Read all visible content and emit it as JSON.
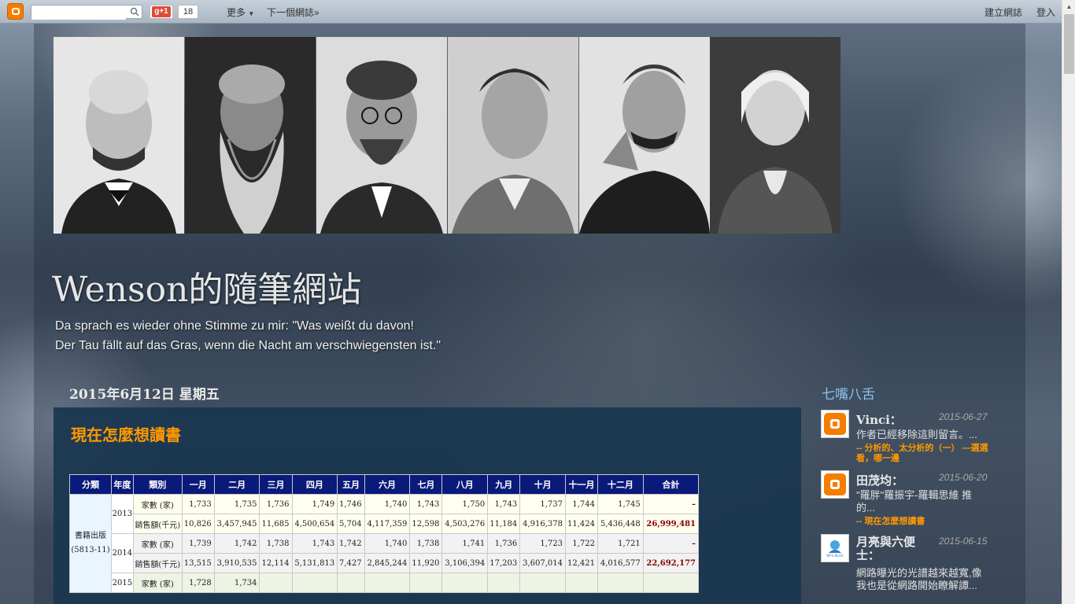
{
  "navbar": {
    "search_placeholder": "",
    "gplus_label": "+1",
    "gplus_g": "g",
    "plus_count": "18",
    "more": "更多",
    "next_blog": "下一個網誌»",
    "create_blog": "建立網誌",
    "login": "登入"
  },
  "header": {
    "title": "Wenson的隨筆網站",
    "description_line1": "Da sprach es wieder ohne Stimme zu mir: \"Was weißt du davon!",
    "description_line2": "Der Tau fällt auf das Gras, wenn die Nacht am verschwiegensten ist.\""
  },
  "post": {
    "date": "2015年6月12日 星期五",
    "title": "現在怎麼想讀書"
  },
  "table": {
    "headers": [
      "分類",
      "年度",
      "類別",
      "一月",
      "二月",
      "三月",
      "四月",
      "五月",
      "六月",
      "七月",
      "八月",
      "九月",
      "十月",
      "十一月",
      "十二月",
      "合計"
    ],
    "category": "書籍出版",
    "category_code": "(5813-11)",
    "type_count": "家數 (家)",
    "type_sales": "銷售額(千元)",
    "years": [
      {
        "year": "2013",
        "count": [
          "1,733",
          "1,735",
          "1,736",
          "1,749",
          "1,746",
          "1,740",
          "1,743",
          "1,750",
          "1,743",
          "1,737",
          "1,744",
          "1,745",
          "–"
        ],
        "sales": [
          "10,826",
          "3,457,945",
          "11,685",
          "4,500,654",
          "5,704",
          "4,117,359",
          "12,598",
          "4,503,276",
          "11,184",
          "4,916,378",
          "11,424",
          "5,436,448",
          "26,999,481"
        ]
      },
      {
        "year": "2014",
        "count": [
          "1,739",
          "1,742",
          "1,738",
          "1,743",
          "1,742",
          "1,740",
          "1,738",
          "1,741",
          "1,736",
          "1,723",
          "1,722",
          "1,721",
          "–"
        ],
        "sales": [
          "13,515",
          "3,910,535",
          "12,114",
          "5,131,813",
          "7,427",
          "2,845,244",
          "11,920",
          "3,106,394",
          "17,203",
          "3,607,014",
          "12,421",
          "4,016,577",
          "22,692,177"
        ]
      },
      {
        "year": "2015",
        "count": [
          "1,728",
          "1,734",
          "",
          "",
          "",
          "",
          "",
          "",
          "",
          "",
          "",
          "",
          ""
        ]
      }
    ]
  },
  "sidebar": {
    "widget_title": "七嘴八舌",
    "comments": [
      {
        "name": "Vinci：",
        "date": "2015-06-27",
        "text": "作者已經移除這則留言。...",
        "link": "-- 分析的、太分析的（一） —選選看，哪一邊",
        "avatar": "blogger-icon"
      },
      {
        "name": "田茂均：",
        "date": "2015-06-20",
        "text": "\"羅胖\"羅振宇-羅輯思維 推的...",
        "link": "-- 現在怎麼想讀書",
        "avatar": "blogger-icon"
      },
      {
        "name": "月亮與六便士：",
        "date": "2015-06-15",
        "text": "網路曝光的光譜越來越寬,像我也是從網路開始瞭解譚...",
        "link": "",
        "avatar": "wfu-blog-icon"
      }
    ],
    "wfu_label": "WFU BLOG"
  },
  "colors": {
    "accent_orange": "#ff9900",
    "table_header": "#0a1a7a",
    "post_bg": "#1b3750",
    "widget_title": "#8fc1ef"
  }
}
